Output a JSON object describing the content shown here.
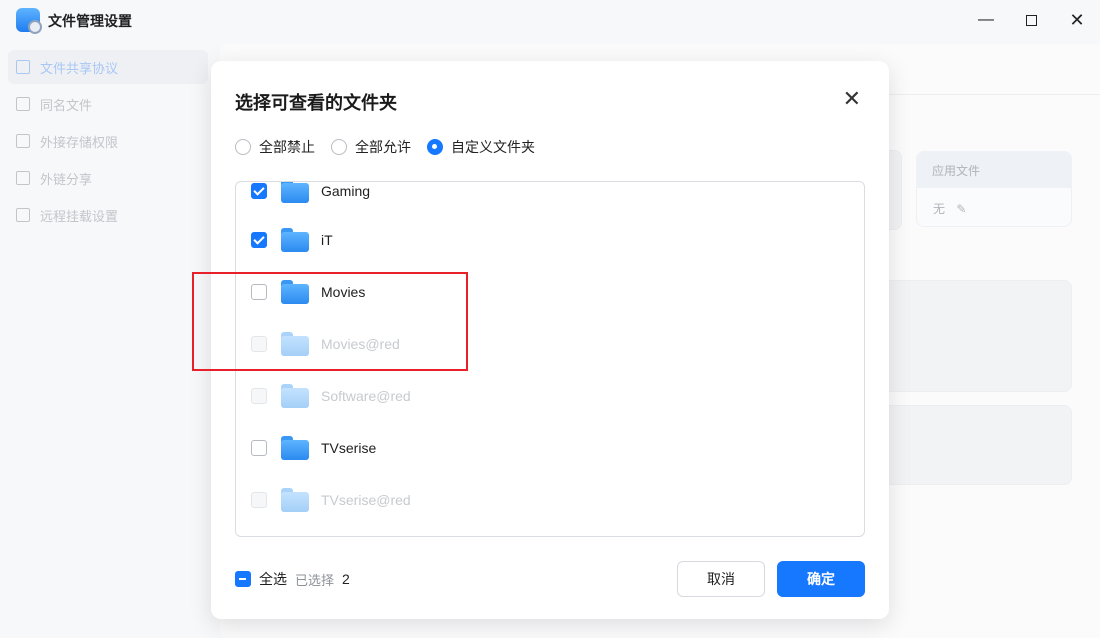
{
  "window": {
    "title": "文件管理设置"
  },
  "sidebar": {
    "items": [
      {
        "label": "文件共享协议",
        "active": true
      },
      {
        "label": "同名文件"
      },
      {
        "label": "外接存储权限"
      },
      {
        "label": "外链分享"
      },
      {
        "label": "远程挂载设置"
      }
    ]
  },
  "background": {
    "column_header": "应用文件",
    "column_value": "无"
  },
  "dialog": {
    "title": "选择可查看的文件夹",
    "radios": [
      {
        "label": "全部禁止",
        "checked": false
      },
      {
        "label": "全部允许",
        "checked": false
      },
      {
        "label": "自定义文件夹",
        "checked": true
      }
    ],
    "folders": [
      {
        "name": "Gaming",
        "checked": true,
        "disabled": false
      },
      {
        "name": "iT",
        "checked": true,
        "disabled": false
      },
      {
        "name": "Movies",
        "checked": false,
        "disabled": false
      },
      {
        "name": "Movies@red",
        "checked": false,
        "disabled": true
      },
      {
        "name": "Software@red",
        "checked": false,
        "disabled": true
      },
      {
        "name": "TVserise",
        "checked": false,
        "disabled": false
      },
      {
        "name": "TVserise@red",
        "checked": false,
        "disabled": true
      }
    ],
    "select_all_label": "全选",
    "selected_label": "已选择",
    "selected_count": "2",
    "cancel_label": "取消",
    "ok_label": "确定"
  },
  "colors": {
    "accent": "#1677ff",
    "highlight_box": "#e8202a"
  }
}
